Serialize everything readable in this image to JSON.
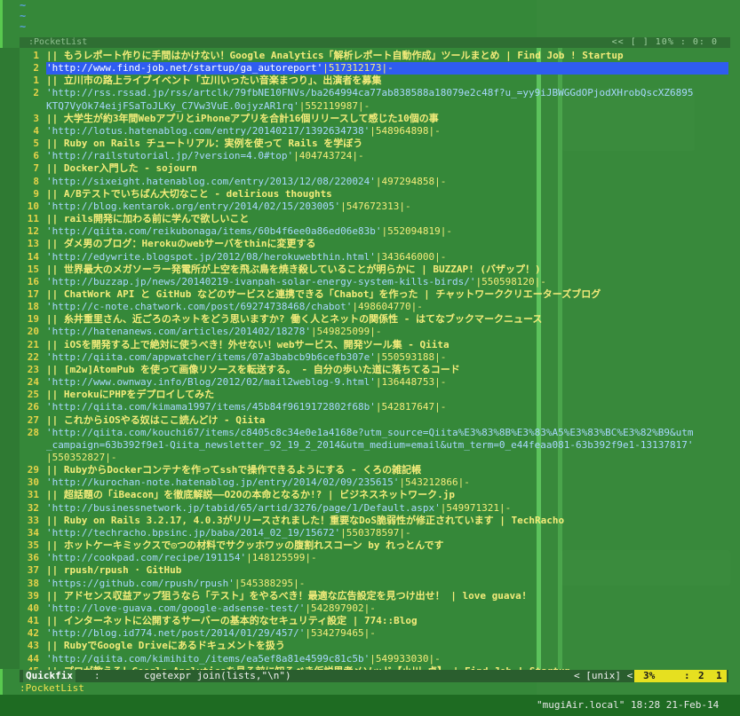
{
  "top_status": {
    "left": ":PocketList",
    "right": "<< [ ]  10% :  0:  0"
  },
  "lines": [
    {
      "n": "1",
      "kind": "title",
      "text": "|| もうレポート作りに手間はかけない！Google Analytics「解析レポート自動作成」ツールまとめ | Find Job ! Startup"
    },
    {
      "n": "2",
      "kind": "url",
      "cur": true,
      "url": "'http://www.find-job.net/startup/ga_autoreport'",
      "tail": "|517312173|-"
    },
    {
      "n": "1",
      "kind": "title",
      "text": "|| 立川市の路上ライブイベント「立川いったい音楽まつり」、出演者を募集"
    },
    {
      "n": "2",
      "kind": "url",
      "url": "'http://rss.rssad.jp/rss/artclk/79fbNE10FNVs/ba264994ca77ab838588a18079e2c48f?u_=yy9iJBWGGdOPjodXHrobQscXZ6895",
      "tail": ""
    },
    {
      "n": "",
      "kind": "cont",
      "url": "KTQ7VyOk74eijFSaToJLKy_C7Vw3VuE.0ojyzAR1rq'",
      "tail": "|552119987|-"
    },
    {
      "n": "3",
      "kind": "title",
      "text": "|| 大学生が約3年間WebアプリとiPhoneアプリを合計16個リリースして感じた10個の事"
    },
    {
      "n": "4",
      "kind": "url",
      "url": "'http://lotus.hatenablog.com/entry/20140217/1392634738'",
      "tail": "|548964898|-"
    },
    {
      "n": "5",
      "kind": "title",
      "text": "|| Ruby on Rails チュートリアル：実例を使って Rails を学ぼう"
    },
    {
      "n": "6",
      "kind": "url",
      "url": "'http://railstutorial.jp/?version=4.0#top'",
      "tail": "|404743724|-"
    },
    {
      "n": "7",
      "kind": "title",
      "text": "|| Docker入門した - sojourn"
    },
    {
      "n": "8",
      "kind": "url",
      "url": "'http://sixeight.hatenablog.com/entry/2013/12/08/220024'",
      "tail": "|497294858|-"
    },
    {
      "n": "9",
      "kind": "title",
      "text": "|| A/Bテストでいちばん大切なこと - delirious thoughts"
    },
    {
      "n": "10",
      "kind": "url",
      "url": "'http://blog.kentarok.org/entry/2014/02/15/203005'",
      "tail": "|547672313|-"
    },
    {
      "n": "11",
      "kind": "title",
      "text": "|| rails開発に加わる前に学んで欲しいこと"
    },
    {
      "n": "12",
      "kind": "url",
      "url": "'http://qiita.com/reikubonaga/items/60b4f6ee0a86ed06e83b'",
      "tail": "|552094819|-"
    },
    {
      "n": "13",
      "kind": "title",
      "text": "|| ダメ男のブログ：Herokuのwebサーバをthinに変更する"
    },
    {
      "n": "14",
      "kind": "url",
      "url": "'http://edywrite.blogspot.jp/2012/08/herokuwebthin.html'",
      "tail": "|343646000|-"
    },
    {
      "n": "15",
      "kind": "title",
      "text": "|| 世界最大のメガソーラー発電所が上空を飛ぶ鳥を焼き殺していることが明らかに | BUZZAP! (バザップ！)"
    },
    {
      "n": "16",
      "kind": "url",
      "url": "'http://buzzap.jp/news/20140219-ivanpah-solar-energy-system-kills-birds/'",
      "tail": "|550598120|-"
    },
    {
      "n": "17",
      "kind": "title",
      "text": "|| ChatWork API と GitHub などのサービスと連携できる「Chabot」を作った | チャットワーククリエーターズブログ"
    },
    {
      "n": "18",
      "kind": "url",
      "url": "'http://c-note.chatwork.com/post/69274738468/chabot'",
      "tail": "|498604770|-"
    },
    {
      "n": "19",
      "kind": "title",
      "text": "|| 糸井重里さん、近ごろのネットをどう思いますか? 働く人とネットの関係性 - はてなブックマークニュース"
    },
    {
      "n": "20",
      "kind": "url",
      "url": "'http://hatenanews.com/articles/201402/18278'",
      "tail": "|549825099|-"
    },
    {
      "n": "21",
      "kind": "title",
      "text": "|| iOSを開発する上で絶対に使うべき！外せない！webサービス、開発ツール集 - Qiita"
    },
    {
      "n": "22",
      "kind": "url",
      "url": "'http://qiita.com/appwatcher/items/07a3babcb9b6cefb307e'",
      "tail": "|550593188|-"
    },
    {
      "n": "23",
      "kind": "title",
      "text": "|| [m2w]AtomPub を使って画像リソースを転送する。 - 自分の歩いた道に落ちてるコード"
    },
    {
      "n": "24",
      "kind": "url",
      "url": "'http://www.ownway.info/Blog/2012/02/mail2weblog-9.html'",
      "tail": "|136448753|-"
    },
    {
      "n": "25",
      "kind": "title",
      "text": "|| HerokuにPHPをデプロイしてみた"
    },
    {
      "n": "26",
      "kind": "url",
      "url": "'http://qiita.com/kimama1997/items/45b84f9619172802f68b'",
      "tail": "|542817647|-"
    },
    {
      "n": "27",
      "kind": "title",
      "text": "|| これからiOSやる奴はここ読んどけ - Qiita"
    },
    {
      "n": "28",
      "kind": "url",
      "url": "'http://qiita.com/kouchi67/items/c8405c8c34e0e1a4168e?utm_source=Qiita%E3%83%8B%E3%83%A5%E3%83%BC%E3%82%B9&utm",
      "tail": ""
    },
    {
      "n": "",
      "kind": "cont",
      "url": "_campaign=63b392f9e1-Qiita_newsletter_92_19_2_2014&utm_medium=email&utm_term=0_e44feaa081-63b392f9e1-13137817'",
      "tail": ""
    },
    {
      "n": "",
      "kind": "cont",
      "url": "",
      "tail": "|550352827|-"
    },
    {
      "n": "29",
      "kind": "title",
      "text": "|| RubyからDockerコンテナを作ってsshで操作できるようにする - くろの雑記帳"
    },
    {
      "n": "30",
      "kind": "url",
      "url": "'http://kurochan-note.hatenablog.jp/entry/2014/02/09/235615'",
      "tail": "|543212866|-"
    },
    {
      "n": "31",
      "kind": "title",
      "text": "|| 超話題の「iBeacon」を徹底解説――O2Oの本命となるか!? | ビジネスネットワーク.jp"
    },
    {
      "n": "32",
      "kind": "url",
      "url": "'http://businessnetwork.jp/tabid/65/artid/3276/page/1/Default.aspx'",
      "tail": "|549971321|-"
    },
    {
      "n": "33",
      "kind": "title",
      "text": "|| Ruby on Rails 3.2.17, 4.0.3がリリースされました！重要なDoS脆弱性が修正されています | TechRacho"
    },
    {
      "n": "34",
      "kind": "url",
      "url": "'http://techracho.bpsinc.jp/baba/2014_02_19/15672'",
      "tail": "|550378597|-"
    },
    {
      "n": "35",
      "kind": "title",
      "text": "|| ホットケーキミックスで◎つの材料でサクッホワッの腹割れスコーン by れっとんです"
    },
    {
      "n": "36",
      "kind": "url",
      "url": "'http://cookpad.com/recipe/191154'",
      "tail": "|148125599|-"
    },
    {
      "n": "37",
      "kind": "title",
      "text": "|| rpush/rpush · GitHub"
    },
    {
      "n": "38",
      "kind": "url",
      "url": "'https://github.com/rpush/rpush'",
      "tail": "|545388295|-"
    },
    {
      "n": "39",
      "kind": "title",
      "text": "|| アドセンス収益アップ狙うなら「テスト」をやるべき！最適な広告設定を見つけ出せ！ | love guava!"
    },
    {
      "n": "40",
      "kind": "url",
      "url": "'http://love-guava.com/google-adsense-test/'",
      "tail": "|542897902|-"
    },
    {
      "n": "41",
      "kind": "title",
      "text": "|| インターネットに公開するサーバーの基本的なセキュリティ設定 | 774::Blog"
    },
    {
      "n": "42",
      "kind": "url",
      "url": "'http://blog.id774.net/post/2014/01/29/457/'",
      "tail": "|534279465|-"
    },
    {
      "n": "43",
      "kind": "title",
      "text": "|| RubyでGoogle Driveにあるドキュメントを扱う"
    },
    {
      "n": "44",
      "kind": "url",
      "url": "'http://qiita.com/kimihito_/items/ea5ef8a81e4599c81c5b'",
      "tail": "|549933030|-"
    },
    {
      "n": "45",
      "kind": "title",
      "text": "|| プロが教える！Google Analyticsを見る前に知るべき仮説思考メソッド【小川 卓】 | Find Job ! Startup"
    }
  ],
  "status_bar": {
    "name": "Quickfix",
    "sep": ":",
    "cmd": "cgetexpr join(lists,\"\\n\")",
    "ff": "< [unix] <",
    "percent": "3%",
    "colon": ":",
    "line": "2",
    "col": "1"
  },
  "cmdline": ":PocketList",
  "menubar": {
    "host": "\"mugiAir.local\" 18:28 21-Feb-14"
  },
  "colors": {
    "terminal_bg": "#3f8a42",
    "url": "#a8d8ff",
    "title": "#f4ec7a",
    "cursor_line": "#2f5cf0",
    "status_pos": "#e6e020"
  }
}
